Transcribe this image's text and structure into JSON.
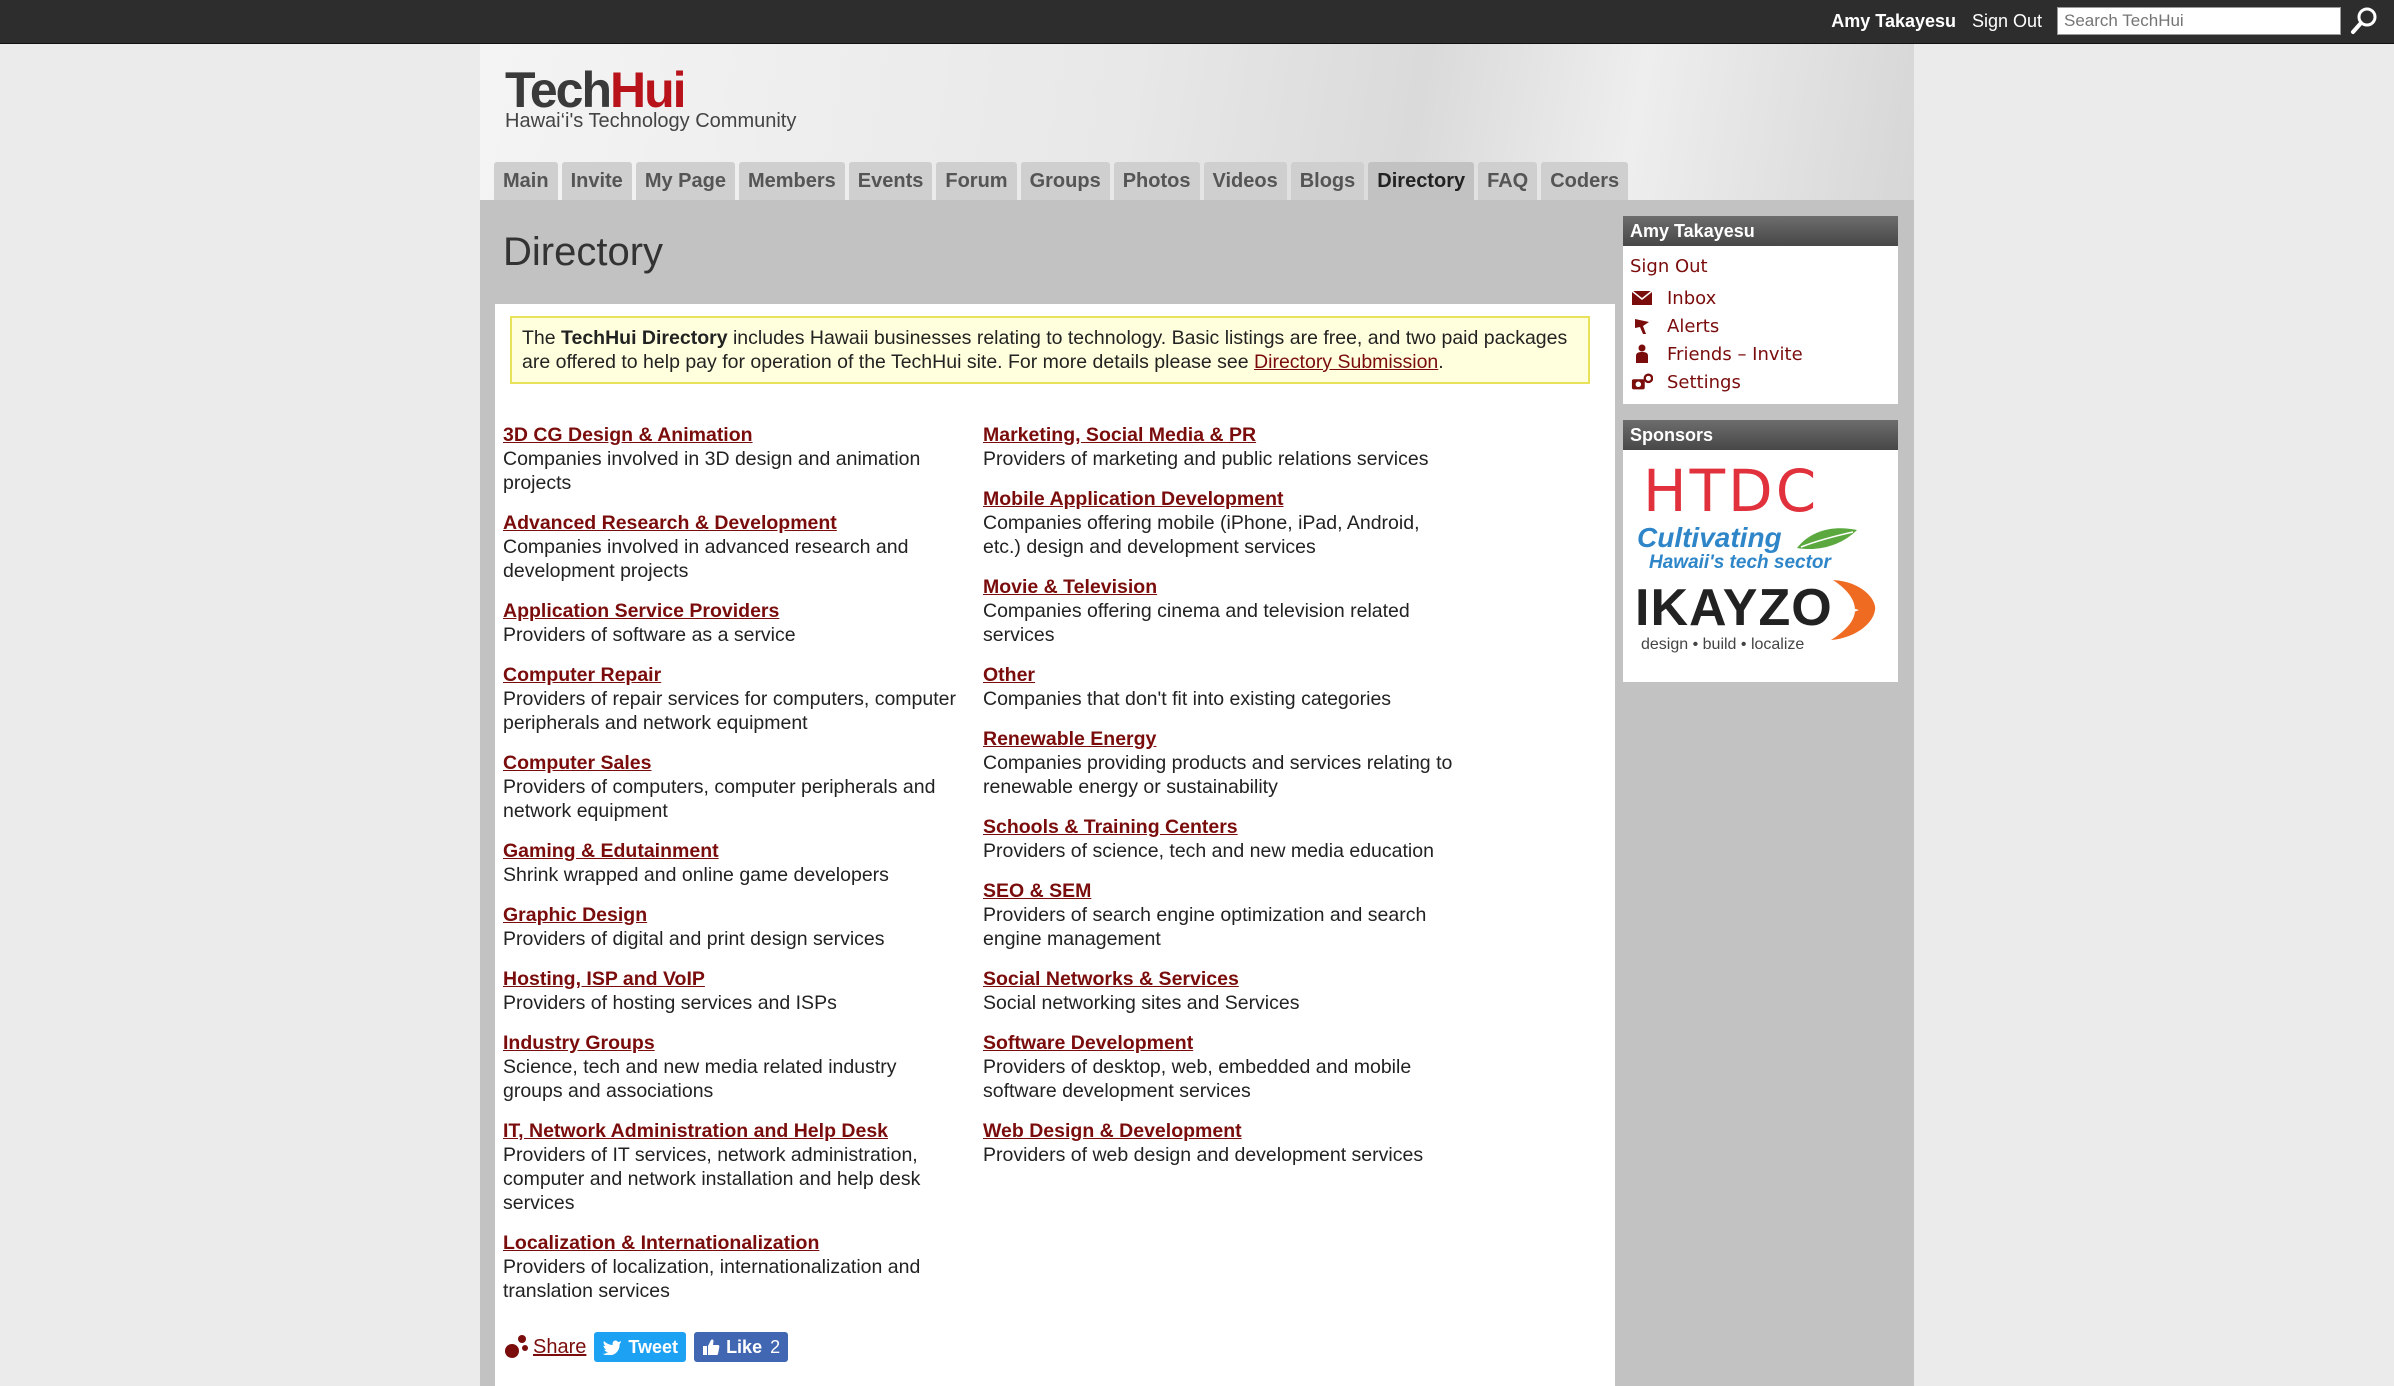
{
  "topbar": {
    "user_name": "Amy Takayesu",
    "sign_out": "Sign Out",
    "search_placeholder": "Search TechHui"
  },
  "logo": {
    "part1": "Tech",
    "part2": "Hui",
    "tagline": "Hawai‘i's Technology Community"
  },
  "nav": {
    "tabs": [
      "Main",
      "Invite",
      "My Page",
      "Members",
      "Events",
      "Forum",
      "Groups",
      "Photos",
      "Videos",
      "Blogs",
      "Directory",
      "FAQ",
      "Coders"
    ],
    "active": "Directory"
  },
  "page": {
    "title": "Directory",
    "notice": {
      "prefix": "The ",
      "bold": "TechHui Directory",
      "text": " includes Hawaii businesses relating to technology. Basic listings are free, and two paid packages are offered to help pay for operation of the TechHui site. For more details please see ",
      "link": "Directory Submission",
      "suffix": "."
    }
  },
  "categories_left": [
    {
      "title": "3D CG Design & Animation",
      "desc": "Companies involved in 3D design and animation projects"
    },
    {
      "title": "Advanced Research & Development",
      "desc": "Companies involved in advanced research and development projects"
    },
    {
      "title": "Application Service Providers",
      "desc": "Providers of software as a service"
    },
    {
      "title": "Computer Repair",
      "desc": "Providers of repair services for computers, computer peripherals and network equipment"
    },
    {
      "title": "Computer Sales",
      "desc": "Providers of computers, computer peripherals and network equipment"
    },
    {
      "title": "Gaming & Edutainment",
      "desc": "Shrink wrapped and online game developers"
    },
    {
      "title": "Graphic Design",
      "desc": "Providers of digital and print design services"
    },
    {
      "title": "Hosting, ISP and VoIP",
      "desc": "Providers of hosting services and ISPs"
    },
    {
      "title": "Industry Groups",
      "desc": "Science, tech and new media related industry groups and associations"
    },
    {
      "title": "IT, Network Administration and Help Desk",
      "desc": "Providers of IT services, network administration, computer and network installation and help desk services"
    },
    {
      "title": "Localization & Internationalization",
      "desc": "Providers of localization, internationalization and translation services"
    }
  ],
  "categories_right": [
    {
      "title": "Marketing, Social Media & PR",
      "desc": "Providers of marketing and public relations services"
    },
    {
      "title": "Mobile Application Development",
      "desc": "Companies offering mobile (iPhone, iPad, Android, etc.) design and development services"
    },
    {
      "title": "Movie & Television",
      "desc": "Companies offering cinema and television related services"
    },
    {
      "title": "Other",
      "desc": "Companies that don't fit into existing categories"
    },
    {
      "title": "Renewable Energy",
      "desc": "Companies providing products and services relating to renewable energy or sustainability"
    },
    {
      "title": "Schools & Training Centers",
      "desc": "Providers of science, tech and new media education"
    },
    {
      "title": "SEO & SEM",
      "desc": "Providers of search engine optimization and search engine management"
    },
    {
      "title": "Social Networks & Services",
      "desc": "Social networking sites and Services"
    },
    {
      "title": "Software Development",
      "desc": "Providers of desktop, web, embedded and mobile software development services"
    },
    {
      "title": "Web Design & Development",
      "desc": "Providers of web design and development services"
    }
  ],
  "share": {
    "share_label": "Share",
    "tweet_label": "Tweet",
    "like_label": "Like",
    "like_count": "2"
  },
  "sidebar": {
    "user_box": {
      "title": "Amy Takayesu",
      "sign_out": "Sign Out",
      "links": [
        {
          "label": "Inbox",
          "icon": "envelope-icon"
        },
        {
          "label": "Alerts",
          "icon": "flag-icon"
        },
        {
          "label": "Friends – Invite",
          "icon": "person-icon"
        },
        {
          "label": "Settings",
          "icon": "gear-icon"
        }
      ]
    },
    "sponsors": {
      "title": "Sponsors",
      "htdc": {
        "name": "HTDC",
        "line1": "Cultivating",
        "line2": "Hawaii's tech sector"
      },
      "ikayzo": {
        "name": "IKAYZO",
        "tagline": "design • build • localize"
      }
    }
  },
  "colors": {
    "link": "#7a0c0c",
    "brand_red": "#b8121b",
    "topbar": "#2d2d2d",
    "notice_bg": "#ffffdd",
    "tweet": "#1da1f2",
    "like": "#4267b2"
  }
}
